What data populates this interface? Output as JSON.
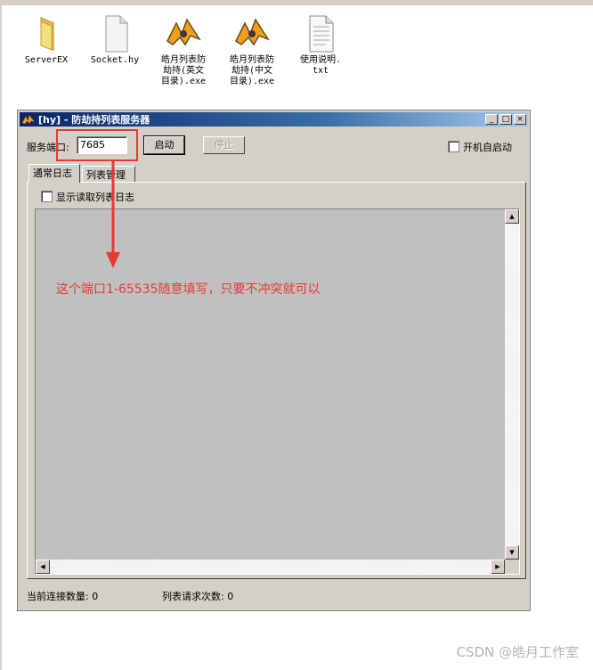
{
  "desktop": {
    "icons": [
      {
        "label": "ServerEX",
        "icon": "folder-icon"
      },
      {
        "label": "Socket.hy",
        "icon": "file-icon"
      },
      {
        "label": "皓月列表防\n劫持(英文\n目录).exe",
        "icon": "app-icon"
      },
      {
        "label": "皓月列表防\n劫持(中文\n目录).exe",
        "icon": "app-icon"
      },
      {
        "label": "使用说明.\ntxt",
        "icon": "text-file-icon"
      }
    ]
  },
  "window": {
    "title": "[hy] - 防劫持列表服务器",
    "controls": {
      "minimize": "_",
      "maximize": "□",
      "close": "×"
    },
    "port_label": "服务端口:",
    "port_value": "7685",
    "start_button": "启动",
    "stop_button": "停止",
    "autostart_label": "开机自启动",
    "tabs": [
      "通常日志",
      "列表管理"
    ],
    "show_read_log_label": "显示读取列表日志",
    "status": {
      "connections": "当前连接数量: 0",
      "list_requests": "列表请求次数: 0"
    }
  },
  "annotation": {
    "text": "这个端口1-65535随意填写，只要不冲突就可以",
    "color": "#e53935"
  },
  "watermark": "CSDN @皓月工作室",
  "colors": {
    "titlebar_start": "#0a246a",
    "titlebar_end": "#a6caf0",
    "window_bg": "#d4d0c8",
    "log_bg": "#c0c0c0"
  }
}
